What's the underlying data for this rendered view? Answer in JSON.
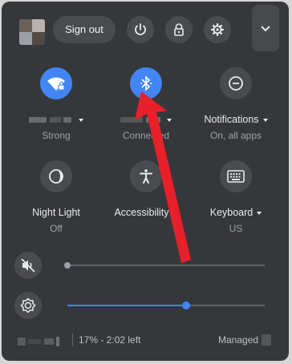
{
  "header": {
    "signout_label": "Sign out"
  },
  "tiles": {
    "network": {
      "label_masked": true,
      "sub": "Strong",
      "icon": "wifi-icon",
      "active": true
    },
    "bluetooth": {
      "label_masked": true,
      "sub": "Connected",
      "icon": "bluetooth-icon",
      "active": true
    },
    "notifications": {
      "label": "Notifications",
      "sub": "On, all apps",
      "icon": "do-not-disturb-icon"
    },
    "nightlight": {
      "label": "Night Light",
      "sub": "Off",
      "icon": "night-light-icon"
    },
    "accessibility": {
      "label": "Accessibility",
      "icon": "accessibility-icon"
    },
    "keyboard": {
      "label": "Keyboard",
      "sub": "US",
      "icon": "keyboard-icon"
    }
  },
  "sliders": {
    "volume": {
      "icon": "volume-muted-icon",
      "level": 0
    },
    "brightness": {
      "icon": "brightness-icon",
      "level": 0.6
    }
  },
  "footer": {
    "battery": "17% - 2:02 left",
    "managed": "Managed"
  },
  "colors": {
    "panel": "#36373b",
    "accent": "#4285f4",
    "annotation_arrow": "#e8202a"
  }
}
